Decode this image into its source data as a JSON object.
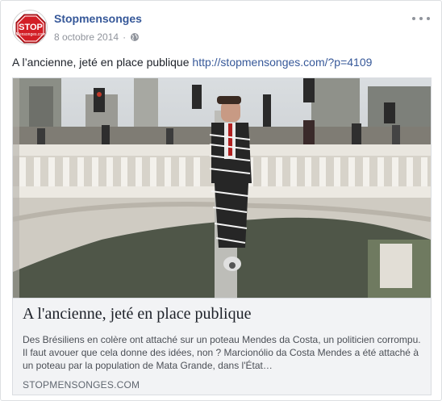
{
  "post": {
    "author": "Stopmensonges",
    "avatar_icon": "stop-sign-logo",
    "avatar_text": "STOP",
    "avatar_subtext": "Mensonges.com",
    "date": "8 octobre 2014",
    "date_separator": "·",
    "audience_icon": "globe-icon",
    "options_icon": "more-options-icon",
    "text": "A l’ancienne, jeté en place publique",
    "link_url": "http://stopmensonges.com/?p=4109"
  },
  "link_preview": {
    "image_subject": "man-tied-to-pole-on-bridge",
    "title": "A l'ancienne, jeté en place publique",
    "description": "Des Brésiliens en colère ont attaché sur un poteau Mendes da Costa, un politicien corrompu. Il faut avouer que cela donne des idées, non ? Marcionólio da Costa Mendes a été attaché à un poteau par la population de Mata Grande, dans l'État…",
    "domain": "STOPMENSONGES.COM"
  },
  "colors": {
    "link": "#365899",
    "meta": "#90949c",
    "preview_bg": "#f2f3f5",
    "stop_red": "#d21f26"
  }
}
